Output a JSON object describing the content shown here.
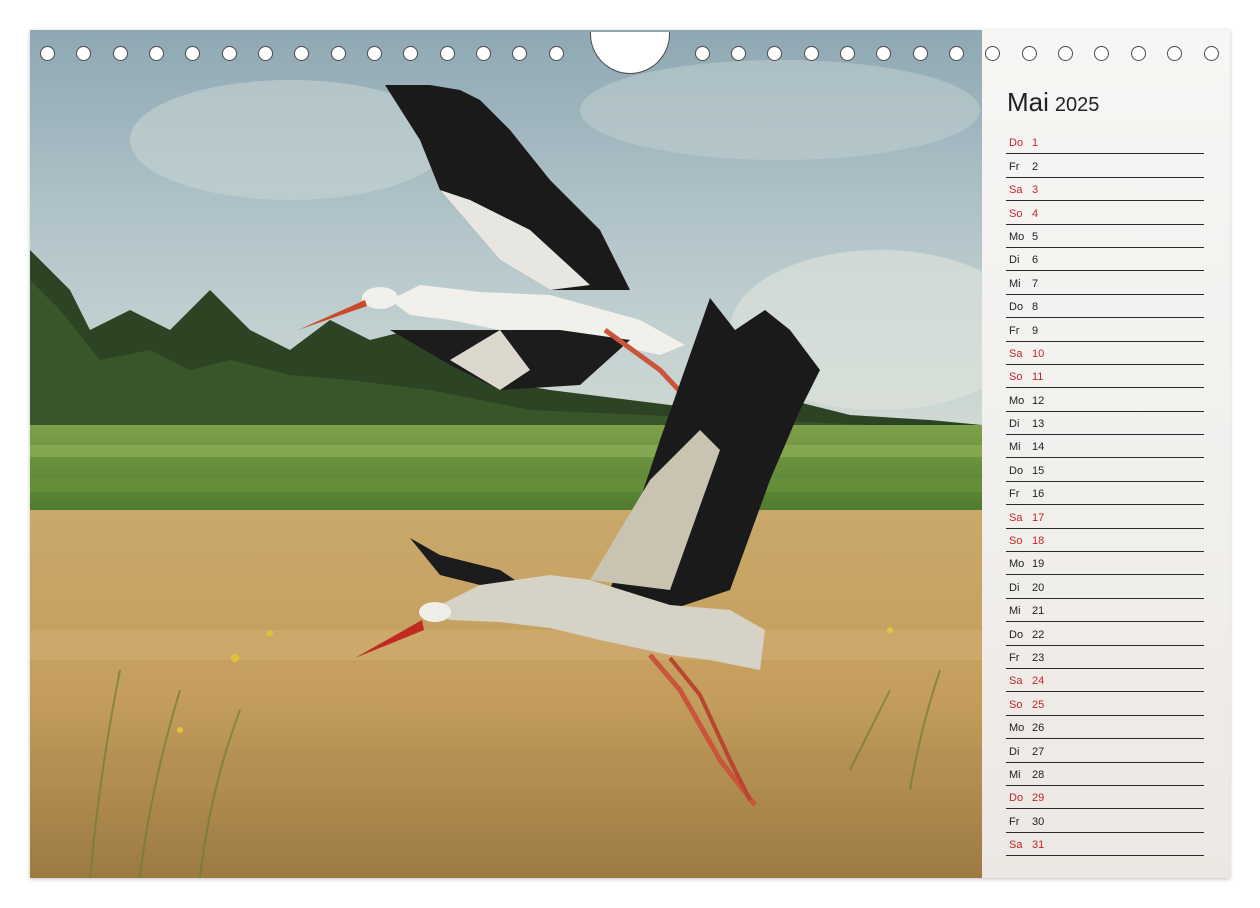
{
  "calendar": {
    "month": "Mai",
    "year": "2025",
    "days": [
      {
        "wd": "Do",
        "d": "1",
        "we": true
      },
      {
        "wd": "Fr",
        "d": "2",
        "we": false
      },
      {
        "wd": "Sa",
        "d": "3",
        "we": true
      },
      {
        "wd": "So",
        "d": "4",
        "we": true
      },
      {
        "wd": "Mo",
        "d": "5",
        "we": false
      },
      {
        "wd": "Di",
        "d": "6",
        "we": false
      },
      {
        "wd": "Mi",
        "d": "7",
        "we": false
      },
      {
        "wd": "Do",
        "d": "8",
        "we": false
      },
      {
        "wd": "Fr",
        "d": "9",
        "we": false
      },
      {
        "wd": "Sa",
        "d": "10",
        "we": true
      },
      {
        "wd": "So",
        "d": "11",
        "we": true
      },
      {
        "wd": "Mo",
        "d": "12",
        "we": false
      },
      {
        "wd": "Di",
        "d": "13",
        "we": false
      },
      {
        "wd": "Mi",
        "d": "14",
        "we": false
      },
      {
        "wd": "Do",
        "d": "15",
        "we": false
      },
      {
        "wd": "Fr",
        "d": "16",
        "we": false
      },
      {
        "wd": "Sa",
        "d": "17",
        "we": true
      },
      {
        "wd": "So",
        "d": "18",
        "we": true
      },
      {
        "wd": "Mo",
        "d": "19",
        "we": false
      },
      {
        "wd": "Di",
        "d": "20",
        "we": false
      },
      {
        "wd": "Mi",
        "d": "21",
        "we": false
      },
      {
        "wd": "Do",
        "d": "22",
        "we": false
      },
      {
        "wd": "Fr",
        "d": "23",
        "we": false
      },
      {
        "wd": "Sa",
        "d": "24",
        "we": true
      },
      {
        "wd": "So",
        "d": "25",
        "we": true
      },
      {
        "wd": "Mo",
        "d": "26",
        "we": false
      },
      {
        "wd": "Di",
        "d": "27",
        "we": false
      },
      {
        "wd": "Mi",
        "d": "28",
        "we": false
      },
      {
        "wd": "Do",
        "d": "29",
        "we": true
      },
      {
        "wd": "Fr",
        "d": "30",
        "we": false
      },
      {
        "wd": "Sa",
        "d": "31",
        "we": true
      }
    ]
  },
  "colors": {
    "weekend_red": "#c0262a",
    "text_dark": "#222222"
  }
}
